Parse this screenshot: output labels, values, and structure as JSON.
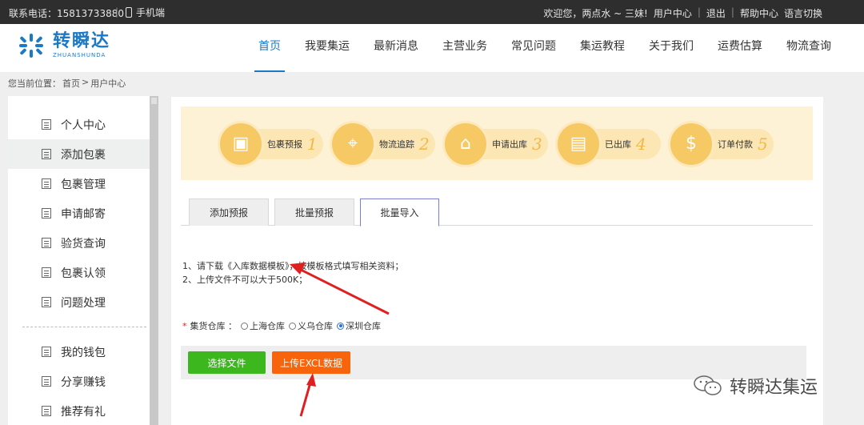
{
  "topbar": {
    "phone": "联系电话：15813733880",
    "divider": "|",
    "mobile": "手机端",
    "welcome": "欢迎您，两点水 ~ 三妹!",
    "user_center": "用户中心",
    "logout": "退出",
    "help": "帮助中心",
    "language": "语言切换"
  },
  "logo": {
    "cn": "转瞬达",
    "en": "ZHUANSHUNDA"
  },
  "nav": [
    "首页",
    "我要集运",
    "最新消息",
    "主营业务",
    "常见问题",
    "集运教程",
    "关于我们",
    "运费估算",
    "物流查询"
  ],
  "breadcrumb": {
    "prefix": "您当前位置：",
    "home": "首页",
    "sep": ">",
    "current": "用户中心"
  },
  "sidebar": {
    "items": [
      "个人中心",
      "添加包裹",
      "包裹管理",
      "申请邮寄",
      "验货查询",
      "包裹认领",
      "问题处理"
    ],
    "items2": [
      "我的钱包",
      "分享赚钱",
      "推荐有礼"
    ]
  },
  "steps": [
    {
      "label": "包裹预报",
      "num": "1",
      "icon": "package-icon"
    },
    {
      "label": "物流追踪",
      "num": "2",
      "icon": "map-pin-icon"
    },
    {
      "label": "申请出库",
      "num": "3",
      "icon": "warehouse-icon"
    },
    {
      "label": "已出库",
      "num": "4",
      "icon": "shipped-boxes-icon"
    },
    {
      "label": "订单付款",
      "num": "5",
      "icon": "money-bag-icon"
    }
  ],
  "tabs": [
    "添加预报",
    "批量预报",
    "批量导入"
  ],
  "instructions": {
    "line1_pre": "1、请下载",
    "line1_link": "《入库数据模板》",
    "line1_post": "，按模板格式填写相关资料；",
    "line2": "2、上传文件不可以大于500K；"
  },
  "warehouse": {
    "required_mark": "*",
    "label": "集货仓库 ：",
    "options": [
      "上海仓库",
      "义乌仓库",
      "深圳仓库"
    ],
    "selected": "深圳仓库"
  },
  "buttons": {
    "choose_file": "选择文件",
    "upload": "上传EXCL数据"
  },
  "watermark": "转瞬达集运",
  "colors": {
    "brand": "#1a79c9",
    "green": "#3cb81e",
    "orange": "#f7640c",
    "arrow": "#e02020"
  }
}
